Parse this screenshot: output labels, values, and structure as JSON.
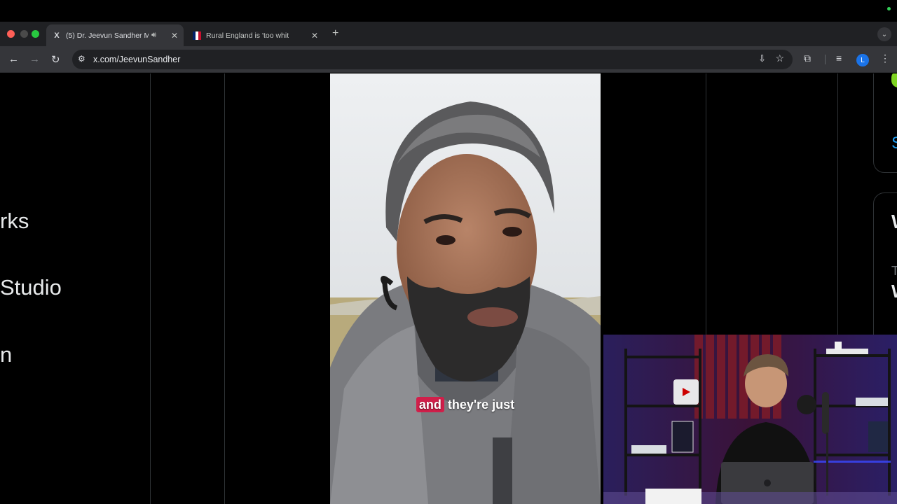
{
  "browser": {
    "tabs": [
      {
        "title": "(5) Dr. Jeevun Sandher M",
        "favicon": "X",
        "audio_icon": "speaker-icon",
        "active": true
      },
      {
        "title": "Rural England is 'too white ar",
        "favicon": "news-flag",
        "active": false
      }
    ],
    "address": "x.com/JeevunSandher",
    "profile_initial": "L"
  },
  "sidebar": {
    "items": [
      {
        "label": "rks"
      },
      {
        "label": "Studio"
      },
      {
        "label": "n"
      }
    ]
  },
  "right_panel": {
    "fragments": [
      "S",
      "W",
      "T",
      "W"
    ]
  },
  "video": {
    "caption_highlight": "and",
    "caption_rest": "they're just"
  },
  "colors": {
    "caption_highlight": "#d11f4a",
    "x_blue": "#1d9bf0",
    "border": "#2f3336"
  }
}
